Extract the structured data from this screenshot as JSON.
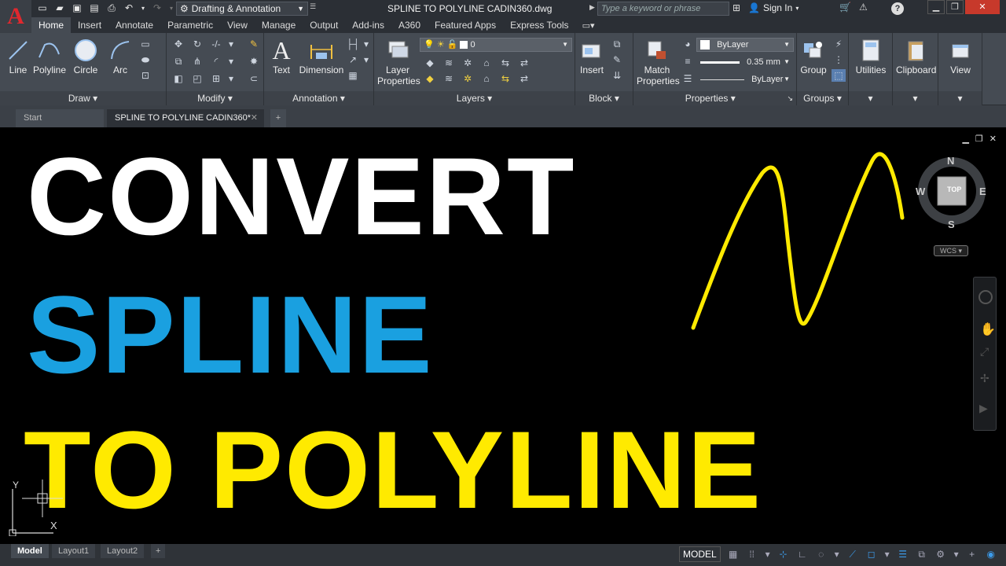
{
  "app": {
    "logo_letter": "A"
  },
  "titlebar": {
    "workspace": "Drafting & Annotation",
    "doc_title": "SPLINE TO POLYLINE CADIN360.dwg",
    "search_placeholder": "Type a keyword or phrase",
    "sign_in": "Sign In"
  },
  "ribbon_tabs": [
    "Home",
    "Insert",
    "Annotate",
    "Parametric",
    "View",
    "Manage",
    "Output",
    "Add-ins",
    "A360",
    "Featured Apps",
    "Express Tools"
  ],
  "ribbon": {
    "draw": {
      "title": "Draw",
      "line": "Line",
      "polyline": "Polyline",
      "circle": "Circle",
      "arc": "Arc"
    },
    "modify": {
      "title": "Modify"
    },
    "annotation": {
      "title": "Annotation",
      "text": "Text",
      "dimension": "Dimension"
    },
    "layers": {
      "title": "Layers",
      "layer_properties_1": "Layer",
      "layer_properties_2": "Properties",
      "current_layer": "0"
    },
    "block": {
      "title": "Block",
      "insert": "Insert"
    },
    "properties": {
      "title": "Properties",
      "match_1": "Match",
      "match_2": "Properties",
      "color": "ByLayer",
      "lineweight": "0.35 mm",
      "linetype": "ByLayer"
    },
    "groups": {
      "title": "Groups",
      "group": "Group"
    },
    "utilities": "Utilities",
    "clipboard": "Clipboard",
    "view": "View"
  },
  "doc_tabs": {
    "start": "Start",
    "file": "SPLINE TO POLYLINE CADIN360*"
  },
  "canvas": {
    "line1": "CONVERT",
    "line2": "SPLINE",
    "line3": "TO POLYLINE",
    "colors": {
      "white": "#ffffff",
      "blue": "#1aa0e0",
      "yellow": "#ffea00"
    },
    "viewcube": {
      "n": "N",
      "s": "S",
      "e": "E",
      "w": "W",
      "top": "TOP"
    },
    "wcs": "WCS",
    "ucs_x": "X",
    "ucs_y": "Y"
  },
  "layout_tabs": {
    "model": "Model",
    "layout1": "Layout1",
    "layout2": "Layout2"
  },
  "status": {
    "model": "MODEL"
  }
}
